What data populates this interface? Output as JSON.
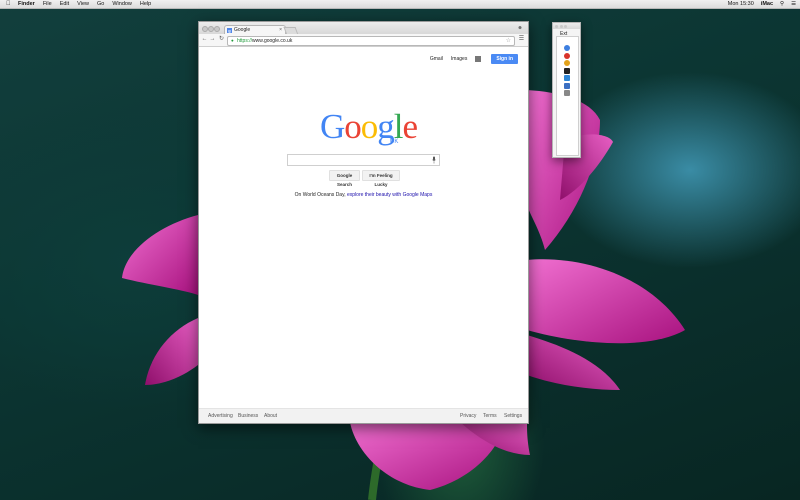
{
  "menubar": {
    "app": "Finder",
    "items": [
      "File",
      "Edit",
      "View",
      "Go",
      "Window",
      "Help"
    ],
    "clock": "Mon 15:30",
    "user": "iMac"
  },
  "browser": {
    "tab_title": "Google",
    "url_scheme": "https://",
    "url_rest": "www.google.co.uk"
  },
  "google": {
    "gmail": "Gmail",
    "images": "Images",
    "sign_in": "Sign in",
    "logo_letters": [
      {
        "ch": "G",
        "color": "#4285f4"
      },
      {
        "ch": "o",
        "color": "#ea4335"
      },
      {
        "ch": "o",
        "color": "#fbbc05"
      },
      {
        "ch": "g",
        "color": "#4285f4"
      },
      {
        "ch": "l",
        "color": "#34a853"
      },
      {
        "ch": "e",
        "color": "#ea4335"
      }
    ],
    "country": "UK",
    "search_button": "Google Search",
    "lucky_button": "I'm Feeling Lucky",
    "promo_text": "On World Oceans Day, ",
    "promo_link": "explore their beauty with Google Maps",
    "footer": {
      "advertising": "Advertising",
      "business": "Business",
      "about": "About",
      "privacy": "Privacy",
      "terms": "Terms",
      "settings": "Settings"
    }
  },
  "ext_panel": {
    "title": "Ext",
    "icons": [
      "globe-icon",
      "record-icon",
      "chrome-icon",
      "x-icon",
      "finder-icon",
      "pen-icon",
      "preview-icon"
    ],
    "icon_colors": [
      "#3d7fe0",
      "#d9342b",
      "#e2a21b",
      "#222222",
      "#2e86d6",
      "#3b6fc2",
      "#888888"
    ]
  }
}
